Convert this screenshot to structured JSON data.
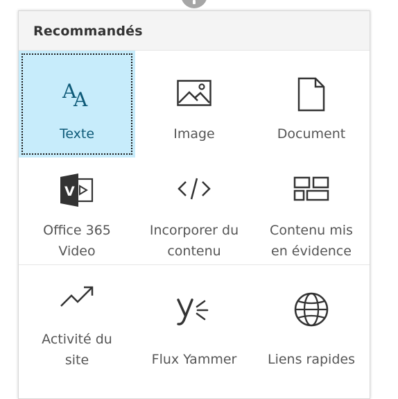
{
  "panel": {
    "title": "Recommandés"
  },
  "tiles": [
    {
      "label": "Texte",
      "icon": "text-icon",
      "selected": true
    },
    {
      "label": "Image",
      "icon": "image-icon"
    },
    {
      "label": "Document",
      "icon": "document-icon"
    },
    {
      "label": "Office 365 Video",
      "line1": "Office 365",
      "line2": "Video",
      "icon": "office-video-icon"
    },
    {
      "label": "Incorporer du contenu",
      "line1": "Incorporer du",
      "line2": "contenu",
      "icon": "embed-code-icon"
    },
    {
      "label": "Contenu mis en évidence",
      "line1": "Contenu mis",
      "line2": "en évidence",
      "icon": "highlighted-content-icon"
    },
    {
      "label": "Activité du site",
      "line1": "Activité du",
      "line2": "site",
      "icon": "site-activity-icon"
    },
    {
      "label": "Flux Yammer",
      "icon": "yammer-icon"
    },
    {
      "label": "Liens rapides",
      "icon": "globe-icon"
    }
  ],
  "colors": {
    "selected_bg": "#c7ecfb",
    "selected_text": "#0e5a78",
    "icon": "#333333",
    "label": "#555555"
  }
}
